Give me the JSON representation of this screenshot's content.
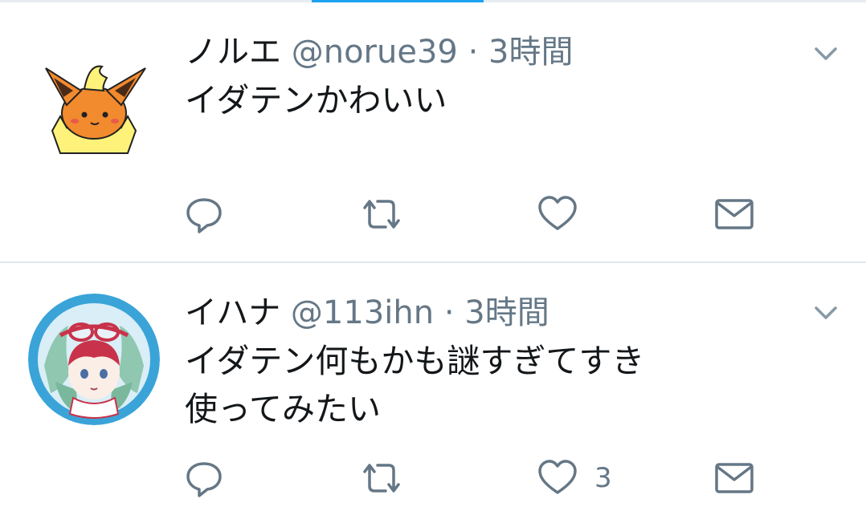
{
  "colors": {
    "accent": "#1da1f2",
    "secondary_text": "#657786",
    "divider": "#e1e8ed"
  },
  "tweets": [
    {
      "display_name": "ノルエ",
      "handle": "@norue39",
      "separator": "·",
      "time": "3時間",
      "text_lines": [
        "イダテンかわいい"
      ],
      "avatar": "fox-creature-avatar",
      "like_count": ""
    },
    {
      "display_name": "イハナ",
      "handle": "@113ihn",
      "separator": "·",
      "time": "3時間",
      "text_lines": [
        "イダテン何もかも謎すぎてすき",
        "使ってみたい"
      ],
      "avatar": "anime-character-avatar",
      "like_count": "3"
    }
  ],
  "icons": {
    "menu": "chevron-down-icon",
    "reply": "reply-icon",
    "retweet": "retweet-icon",
    "like": "heart-icon",
    "dm": "envelope-icon"
  }
}
